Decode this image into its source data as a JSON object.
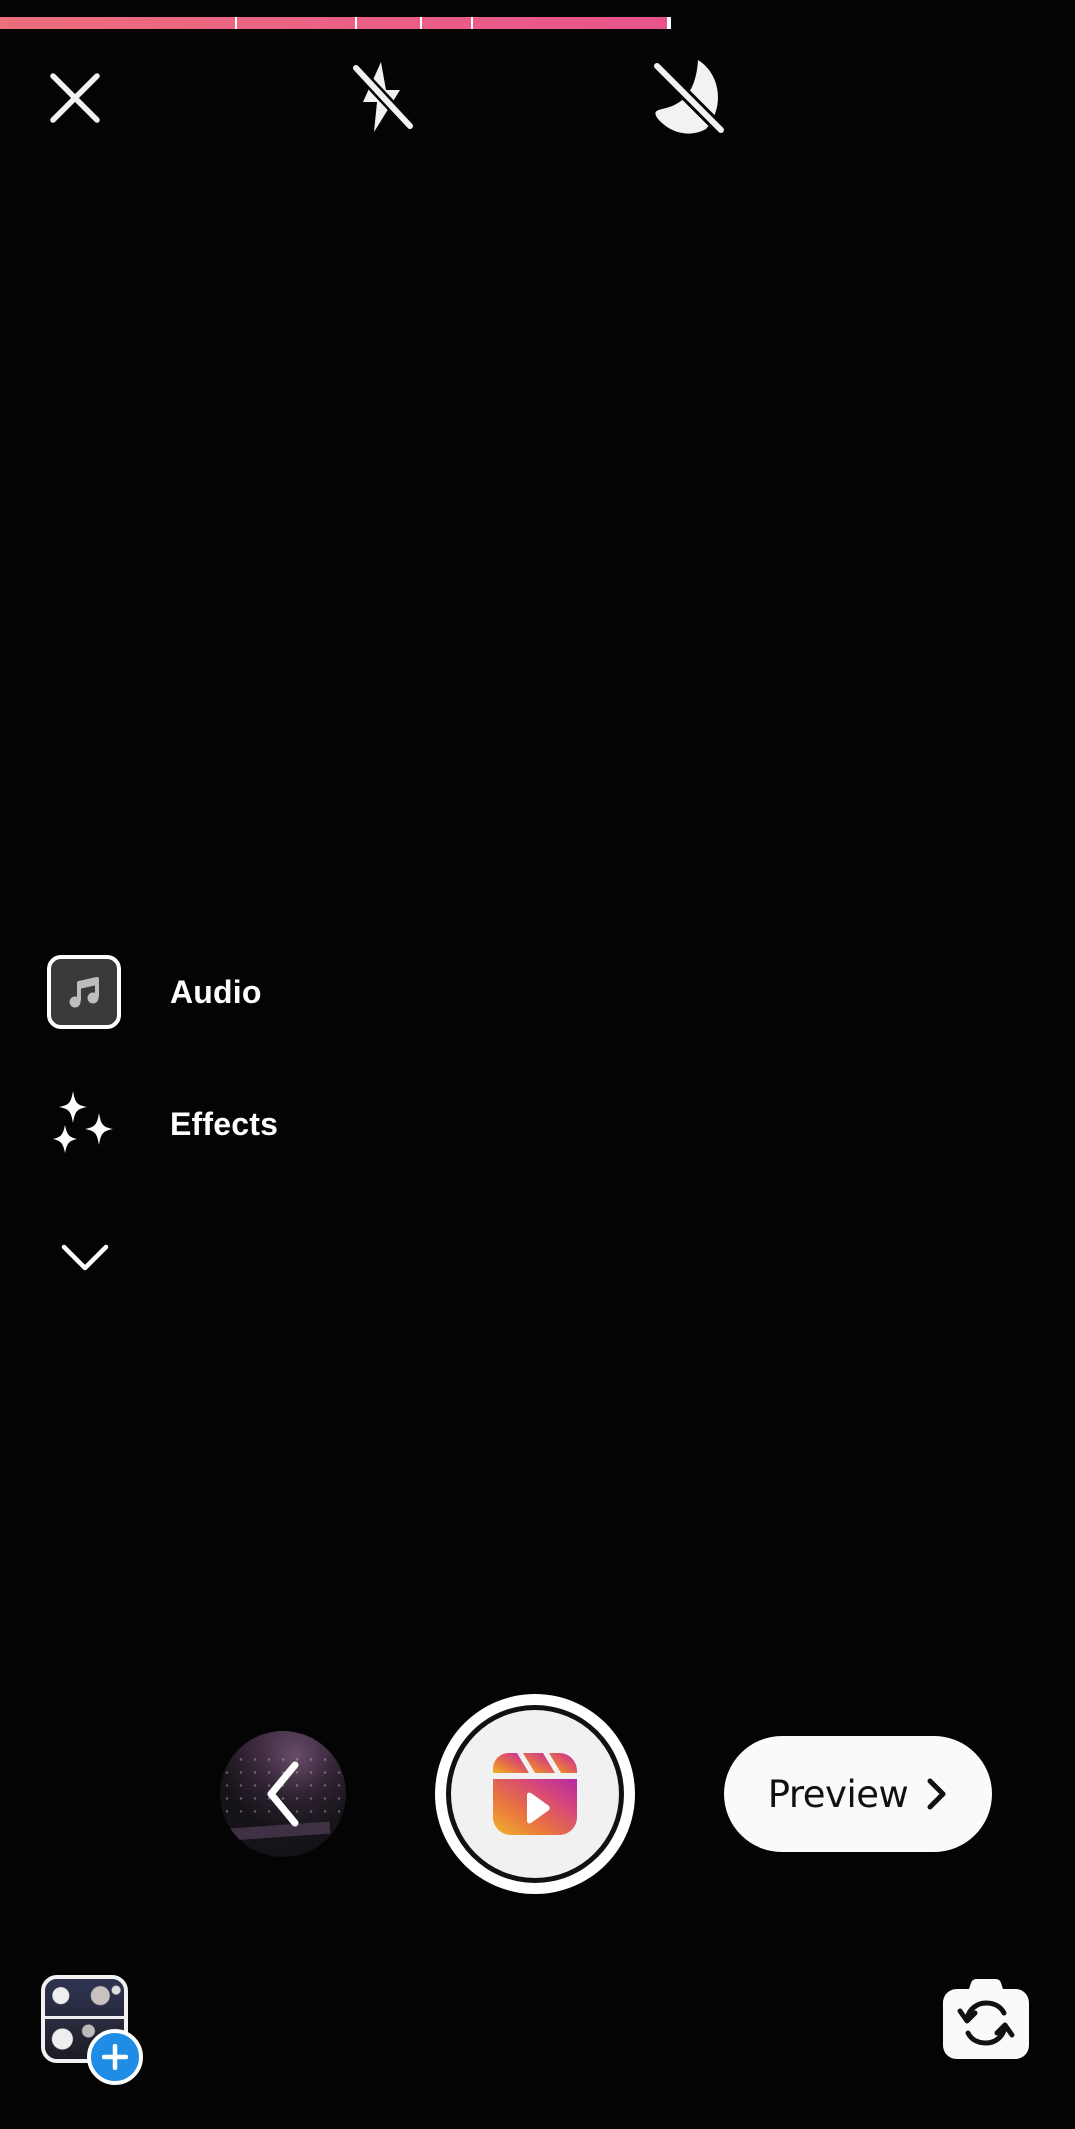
{
  "recording": {
    "progress_fraction": 0.622,
    "clip_fractions": [
      0.22,
      0.112,
      0.061,
      0.047,
      0.182
    ],
    "clip_count": 5,
    "progress_color_start": "#ec6f7c",
    "progress_color_end": "#e9538c"
  },
  "top_bar": {
    "close": {
      "icon": "close-icon",
      "label": "Close"
    },
    "flash": {
      "icon": "flash-off-icon",
      "label": "Flash off"
    },
    "night_mode": {
      "icon": "night-mode-off-icon",
      "label": "Night mode off"
    }
  },
  "tools": [
    {
      "label": "Audio",
      "icon": "music-note-icon"
    },
    {
      "label": "Effects",
      "icon": "sparkles-icon"
    }
  ],
  "tools_expand": {
    "icon": "chevron-down-icon",
    "label": "More tools"
  },
  "capture": {
    "back_icon": "chevron-left-icon",
    "record_icon": "reels-icon",
    "preview_label": "Preview",
    "preview_icon": "chevron-right-icon"
  },
  "bottom_bar": {
    "gallery_icon": "gallery-thumbnail",
    "gallery_add_icon": "plus-icon",
    "flip_icon": "flip-camera-icon"
  },
  "colors": {
    "background": "#050405",
    "gallery_badge": "#1f8ce6",
    "reels_gradient": [
      "#f2b52a",
      "#e9753f",
      "#d6477a",
      "#b52aa2"
    ]
  }
}
